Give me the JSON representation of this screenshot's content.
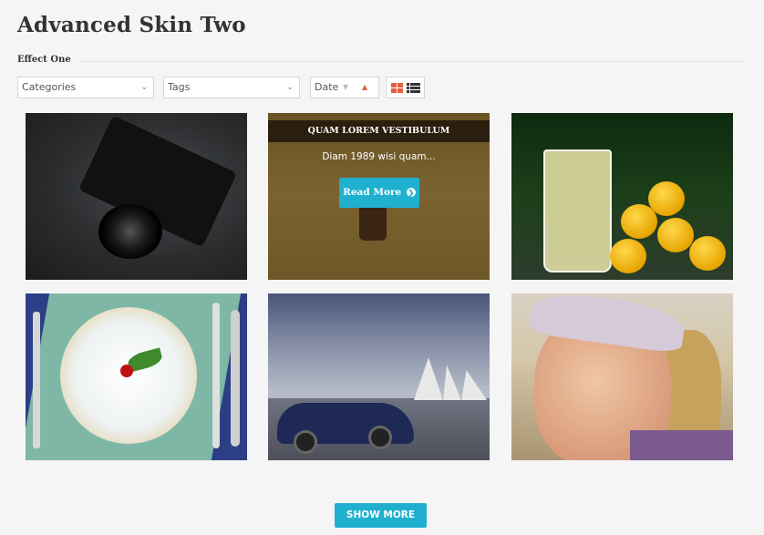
{
  "header": {
    "title": "Advanced Skin Two",
    "subtitle": "Effect One"
  },
  "filters": {
    "categories": {
      "selected": "Categories",
      "icon": "chevron-down-icon"
    },
    "tags": {
      "selected": "Tags",
      "icon": "chevron-down-icon"
    },
    "sort": {
      "selected": "Date",
      "desc_icon": "triangle-down-icon",
      "asc_icon": "triangle-up-icon",
      "active_color": "#e55f3b"
    },
    "layout": {
      "grid_icon": "grid-view-icon",
      "list_icon": "list-view-icon",
      "active": "grid"
    }
  },
  "gallery": {
    "items": [
      {
        "image": "camera"
      },
      {
        "image": "figure",
        "overlay": {
          "title": "QUAM LOREM VESTIBULUM",
          "description": "Diam 1989 wisi quam...",
          "button_label": "Read More",
          "button_icon": "arrow-circle-right-icon"
        }
      },
      {
        "image": "lemonade"
      },
      {
        "image": "plate-with-cherry"
      },
      {
        "image": "car-opera-house"
      },
      {
        "image": "woman-portrait"
      }
    ]
  },
  "footer": {
    "show_more_label": "SHOW MORE"
  },
  "colors": {
    "accent": "#1fb0cf",
    "sort_active": "#e55f3b",
    "background": "#f5f5f5"
  }
}
